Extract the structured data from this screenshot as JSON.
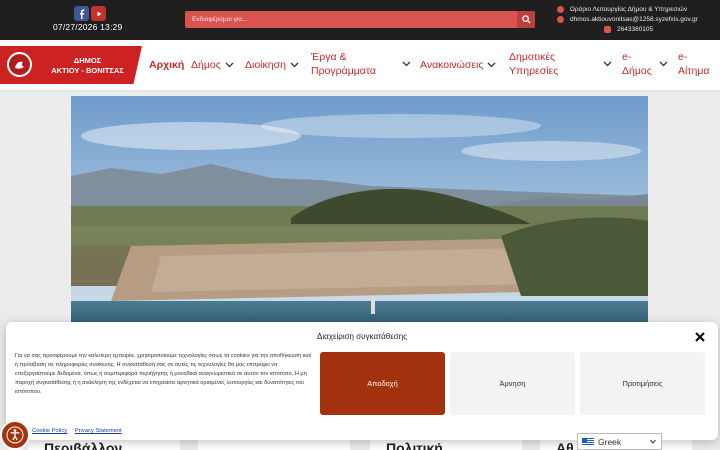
{
  "topbar": {
    "datetime": "07/27/2026 13:29",
    "search_placeholder": "Ενδιαφέρομαι για...",
    "social": [
      "facebook-icon",
      "youtube-icon"
    ],
    "contact": {
      "hours": "Ωράριο Λειτουργίας Δήμου & Υπηρεσιών",
      "email": "dhmos.aktiouvonitsas@1258.syzefxis.gov.gr",
      "phone": "2643360105"
    }
  },
  "header": {
    "logo_line1": "ΔΗΜΟΣ",
    "logo_line2": "ΑΚΤΙΟΥ - ΒΟΝΙΤΣΑΣ",
    "nav": [
      {
        "label": "Αρχική"
      },
      {
        "label": "Δήμος"
      },
      {
        "label": "Διοίκηση"
      },
      {
        "label1": "Έργα &",
        "label2": "Προγράμματα"
      },
      {
        "label": "Ανακοινώσεις"
      },
      {
        "label1": "Δημοτικές",
        "label2": "Υπηρεσίες"
      },
      {
        "label1": "e-",
        "label2": "Δήμος"
      },
      {
        "label1": "e-",
        "label2": "Αίτημα"
      }
    ]
  },
  "cards": {
    "c1": "Περιβάλλον",
    "c2": "Πολιτική",
    "c3": "Αθ"
  },
  "cookie_modal": {
    "title": "Διαχείριση συγκατάθεσης",
    "body": "Για να σας προσφέρουμε την καλύτερη εμπειρία, χρησιμοποιούμε τεχνολογίες όπως τα cookies για την αποθήκευση και/ή πρόσβαση σε πληροφορίες συσκευής. Η συγκατάθεσή σας σε αυτές τις τεχνολογίες θα μας επιτρέψει να επεξεργαστούμε δεδομένα, όπως η συμπεριφορά περιήγησης ή μοναδικά αναγνωριστικά σε αυτόν τον ιστότοπο. Η μη παροχή συγκατάθεσης ή η ανάκληση της ενδέχεται να επηρεάσει αρνητικά ορισμένες λειτουργίες και δυνατότητες του ιστότοπου.",
    "accept": "Αποδοχή",
    "deny": "Άρνηση",
    "preferences": "Προτιμήσεις",
    "link_policy": "Cookie Policy",
    "link_privacy": "Privacy Statement"
  },
  "language": {
    "selected": "Greek"
  },
  "colors": {
    "accent": "#cc2222",
    "accept_button": "#a3330f",
    "topbar": "#1f1f1f",
    "search": "#d9534f"
  }
}
